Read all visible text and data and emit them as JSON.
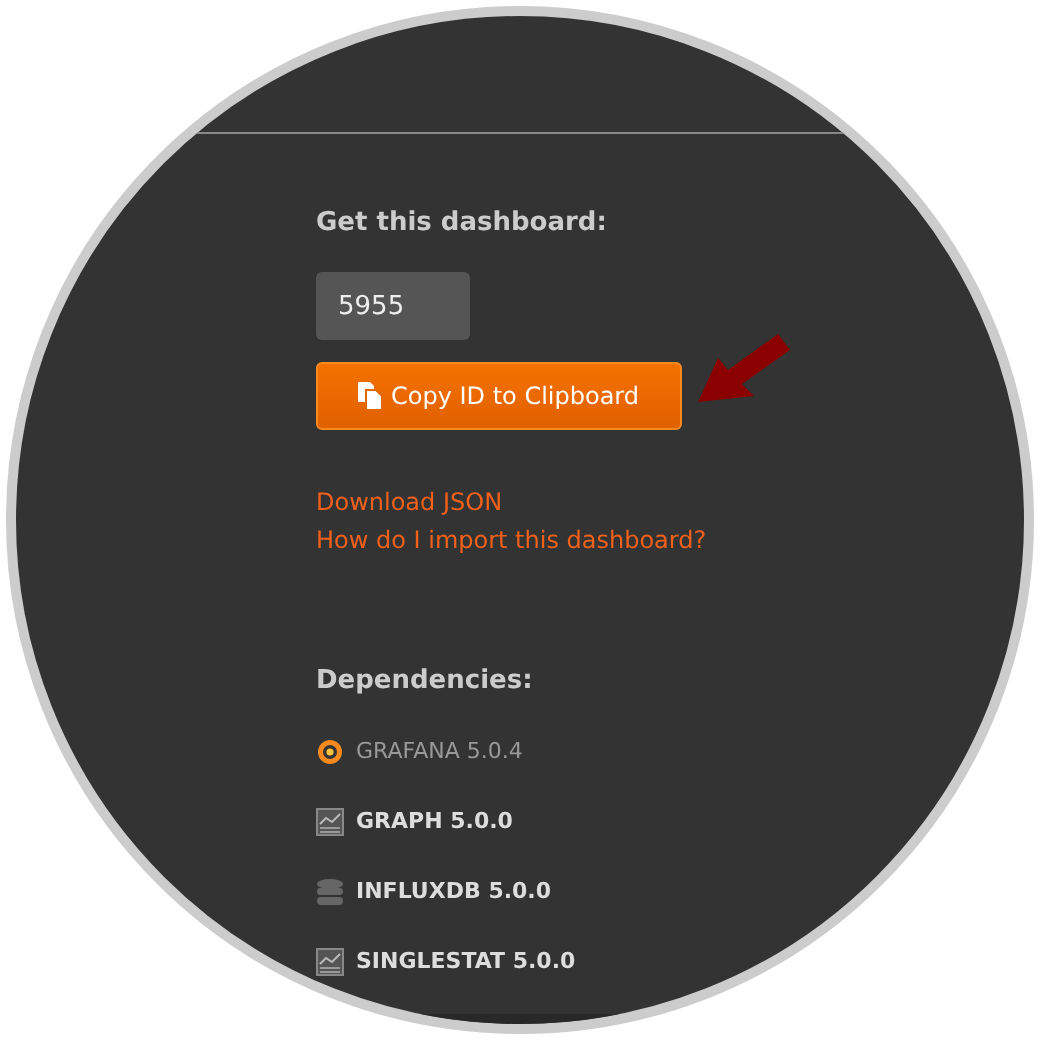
{
  "get_dashboard": {
    "heading": "Get this dashboard:",
    "id_value": "5955",
    "copy_button": "Copy ID to Clipboard"
  },
  "links": [
    "Download JSON",
    "How do I import this dashboard?"
  ],
  "dependencies": {
    "heading": "Dependencies:",
    "items": [
      {
        "kind": "app",
        "label": "GRAFANA 5.0.4"
      },
      {
        "kind": "panel",
        "label": "GRAPH 5.0.0"
      },
      {
        "kind": "datasource",
        "label": "INFLUXDB 5.0.0"
      },
      {
        "kind": "panel",
        "label": "SINGLESTAT 5.0.0"
      }
    ]
  }
}
